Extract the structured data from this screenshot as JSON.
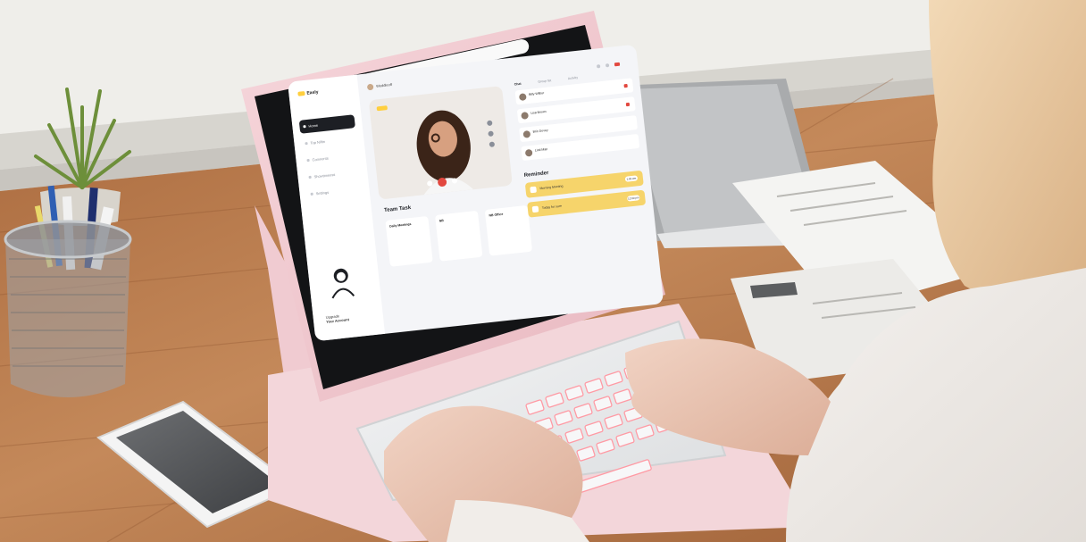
{
  "tablet_app": {
    "brand": "Easly",
    "user_name": "Weddleoff",
    "nav": [
      "Home",
      "Top Nifitn",
      "Comnents",
      "Showtimeess",
      "Settings"
    ],
    "promo": [
      "Upgrade",
      "Your Account"
    ],
    "team_task_title": "Team Task",
    "task_cards": [
      "Daily Meetings",
      "NB",
      "NB Office"
    ],
    "panel_tabs": [
      "Chat",
      "Group list",
      "Activity"
    ],
    "contacts": [
      "Billy Wilbur",
      "Lisa Brown",
      "Brin Dovey",
      "Lind Man"
    ],
    "reminder_title": "Reminder",
    "reminders": [
      {
        "label": "Morning Meeting",
        "time": "1:00 am"
      },
      {
        "label": "Today for sure",
        "time": "12:00 pm"
      }
    ]
  },
  "colors": {
    "case_pink": "#f1c9cf",
    "desk_wood": "#b8794b",
    "window_sill": "#e9e8e4",
    "keyboard": "#ebeced",
    "key_backlight": "#ff8a96",
    "accent_yellow": "#f6d46b"
  }
}
